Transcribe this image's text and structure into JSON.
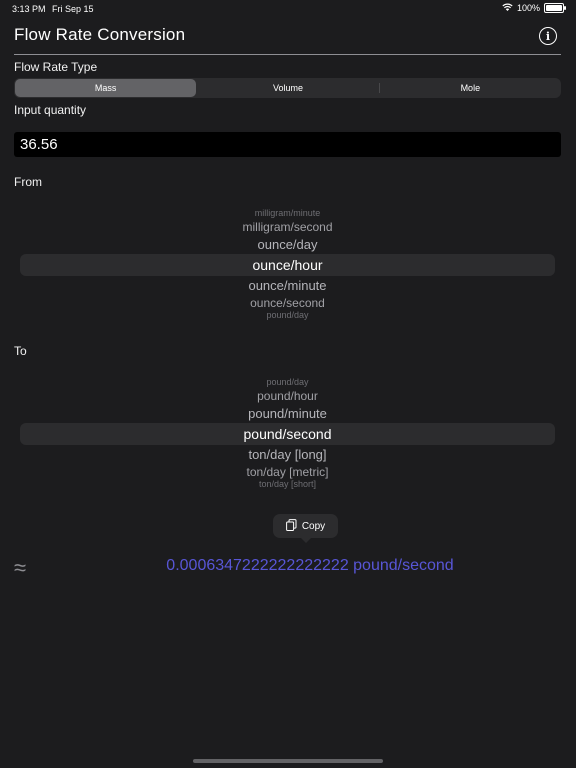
{
  "status": {
    "time": "3:13 PM",
    "date": "Fri Sep 15",
    "battery": "100%"
  },
  "app": {
    "title": "Flow Rate Conversion"
  },
  "flow_type": {
    "label": "Flow Rate Type",
    "options": [
      "Mass",
      "Volume",
      "Mole"
    ],
    "selected": "Mass"
  },
  "input": {
    "label": "Input quantity",
    "value": "36.56"
  },
  "from": {
    "label": "From",
    "items": [
      "milligram/minute",
      "milligram/second",
      "ounce/day",
      "ounce/hour",
      "ounce/minute",
      "ounce/second",
      "pound/day"
    ],
    "selected": "ounce/hour"
  },
  "to": {
    "label": "To",
    "items": [
      "pound/day",
      "pound/hour",
      "pound/minute",
      "pound/second",
      "ton/day [long]",
      "ton/day [metric]",
      "ton/day [short]"
    ],
    "selected": "pound/second"
  },
  "copy": {
    "label": "Copy"
  },
  "result": {
    "approx_symbol": "≈",
    "value": "0.0006347222222222222 pound/second"
  },
  "colors": {
    "accent": "#5856d6",
    "background": "#1c1c1e"
  }
}
